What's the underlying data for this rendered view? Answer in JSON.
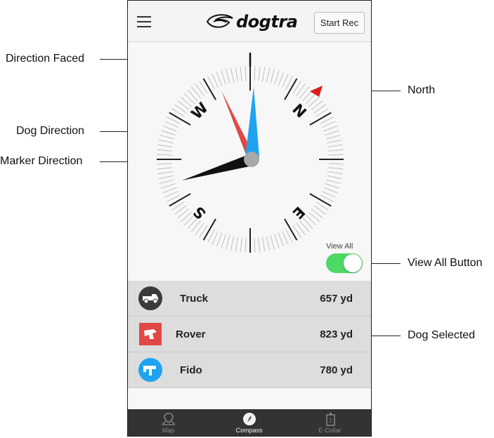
{
  "header": {
    "logo_text": "dogtra",
    "start_rec_label": "Start Rec"
  },
  "compass": {
    "cardinals": [
      "N",
      "E",
      "S",
      "W"
    ],
    "view_all_label": "View All",
    "view_all_on": true,
    "toggle_on_color": "#4cd964",
    "north_marker_color": "#e01a1a",
    "dog_needle_color": "#e04848",
    "marker_needle_color": "#1fa3f0",
    "marker_direction_color": "#111111"
  },
  "list": {
    "items": [
      {
        "name": "Truck",
        "distance": "657 yd",
        "icon": "truck-icon",
        "icon_bg": "#3a3a3a"
      },
      {
        "name": "Rover",
        "distance": "823 yd",
        "icon": "dog-icon",
        "icon_bg": "#e04848"
      },
      {
        "name": "Fido",
        "distance": "780 yd",
        "icon": "dog-icon",
        "icon_bg": "#1fa3f0"
      }
    ]
  },
  "tabbar": {
    "tabs": [
      {
        "label": "Map",
        "icon": "map-pin-icon",
        "active": false
      },
      {
        "label": "Compass",
        "icon": "compass-icon",
        "active": true
      },
      {
        "label": "E-Collar",
        "icon": "collar-icon",
        "active": false
      }
    ]
  },
  "callouts": {
    "direction_faced": "Direction Faced",
    "dog_direction": "Dog Direction",
    "marker_direction": "Marker Direction",
    "north": "North",
    "view_all_button": "View All Button",
    "dog_selected": "Dog Selected"
  }
}
